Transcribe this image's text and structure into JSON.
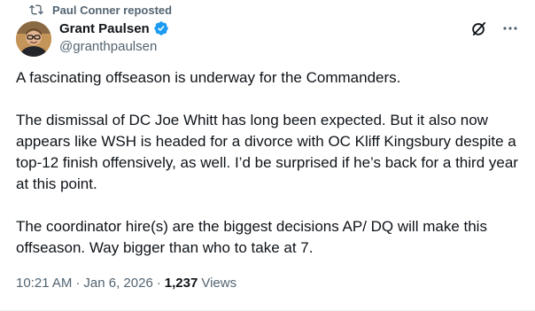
{
  "repost": {
    "icon": "repost-icon",
    "label": "Paul Conner reposted"
  },
  "author": {
    "display_name": "Grant Paulsen",
    "handle": "@granthpaulsen",
    "verified_icon": "verified-badge-icon",
    "verified_color": "#1d9bf0"
  },
  "actions": {
    "grok_icon": "grok-icon",
    "more_icon": "more-options-icon"
  },
  "tweet": {
    "paragraphs": [
      "A fascinating offseason is underway for the Commanders.",
      "The dismissal of DC Joe Whitt has long been expected. But it also now appears like WSH is headed for a divorce with OC Kliff Kingsbury despite a top-12 finish offensively, as well. I’d be surprised if he’s back for a third year at this point.",
      "The coordinator hire(s) are the biggest decisions AP/ DQ will make this offseason. Way bigger than who to take at 7."
    ]
  },
  "meta": {
    "time": "10:21 AM",
    "separator": "·",
    "date": "Jan 6, 2026",
    "views_count": "1,237",
    "views_label": "Views"
  },
  "colors": {
    "text_primary": "#0f1419",
    "text_secondary": "#536471",
    "accent": "#1d9bf0"
  }
}
